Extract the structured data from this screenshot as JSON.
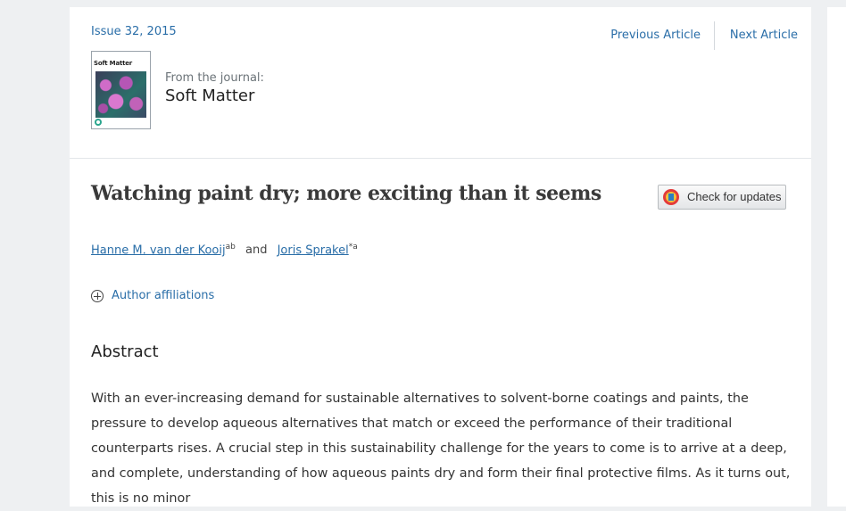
{
  "header": {
    "issue": "Issue 32, 2015",
    "previous_article": "Previous Article",
    "next_article": "Next Article"
  },
  "journal": {
    "cover_title": "Soft Matter",
    "from_label": "From the journal:",
    "name": "Soft Matter"
  },
  "article": {
    "title": "Watching paint dry; more exciting than it seems",
    "check_updates": "Check for updates",
    "authors": [
      {
        "name": "Hanne M. van der Kooij",
        "sup": "ab"
      },
      {
        "name": "Joris Sprakel",
        "sup": "*a"
      }
    ],
    "authors_conjunction": "and",
    "affiliations_label": "Author affiliations"
  },
  "abstract": {
    "heading": "Abstract",
    "text": "With an ever-increasing demand for sustainable alternatives to solvent-borne coatings and paints, the pressure to develop aqueous alternatives that match or exceed the performance of their traditional counterparts rises. A crucial step in this sustainability challenge for the years to come is to arrive at a deep, and complete, understanding of how aqueous paints dry and form their final protective films. As it turns out, this is no minor"
  }
}
